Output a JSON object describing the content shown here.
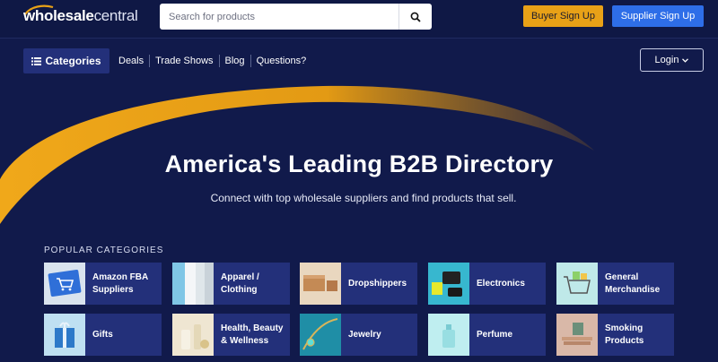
{
  "header": {
    "logo_text_bold": "wholesale",
    "logo_text_light": "central",
    "search_placeholder": "Search for products",
    "buyer_signup": "Buyer Sign Up",
    "supplier_signup": "Supplier Sign Up"
  },
  "nav": {
    "categories": "Categories",
    "links": [
      "Deals",
      "Trade Shows",
      "Blog",
      "Questions?"
    ],
    "login": "Login"
  },
  "hero": {
    "title": "America's Leading B2B Directory",
    "subtitle": "Connect with top wholesale suppliers and find products that sell."
  },
  "popular": {
    "heading": "POPULAR CATEGORIES",
    "items": [
      {
        "line1": "Amazon FBA",
        "line2": "Suppliers"
      },
      {
        "line1": "Apparel /",
        "line2": "Clothing"
      },
      {
        "line1": "Dropshippers",
        "line2": ""
      },
      {
        "line1": "Electronics",
        "line2": ""
      },
      {
        "line1": "General",
        "line2": "Merchandise"
      },
      {
        "line1": "Gifts",
        "line2": ""
      },
      {
        "line1": "Health, Beauty",
        "line2": "& Wellness"
      },
      {
        "line1": "Jewelry",
        "line2": ""
      },
      {
        "line1": "Perfume",
        "line2": ""
      },
      {
        "line1": "Smoking",
        "line2": "Products"
      }
    ]
  },
  "colors": {
    "background": "#111a4b",
    "header": "#0f1845",
    "card": "#23307a",
    "accent_orange": "#e8a117",
    "accent_blue": "#2e6ee8"
  }
}
